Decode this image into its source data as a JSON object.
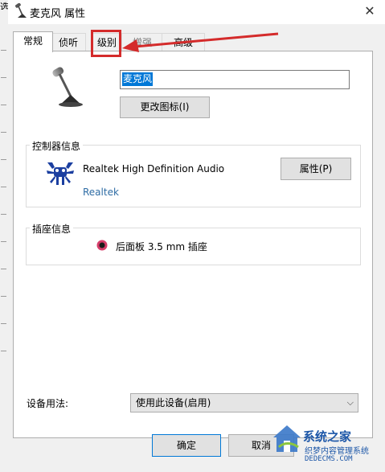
{
  "window": {
    "title": "麦克风 属性",
    "left_fragment": "选",
    "close_glyph": "✕"
  },
  "tabs": [
    {
      "label": "常规",
      "active": true
    },
    {
      "label": "侦听",
      "active": false
    },
    {
      "label": "级别",
      "active": false
    },
    {
      "label": "增强",
      "active": false
    },
    {
      "label": "高级",
      "active": false
    }
  ],
  "device": {
    "name_value": "麦克风",
    "change_icon_button": "更改图标(I)"
  },
  "controller": {
    "group_label": "控制器信息",
    "name": "Realtek High Definition Audio",
    "vendor_link": "Realtek",
    "properties_button": "属性(P)"
  },
  "jack": {
    "group_label": "插座信息",
    "label": "后面板 3.5 mm 插座",
    "color": "#d63d6a"
  },
  "usage": {
    "label": "设备用法:",
    "selected": "使用此设备(启用)"
  },
  "footer": {
    "ok_button": "确定",
    "cancel_button": "取消"
  },
  "annotation": {
    "color": "#d42b2b"
  },
  "watermark": {
    "brand": "系统之家",
    "sub": "织梦内容管理系统",
    "url": "DEDECMS.COM"
  },
  "icons": {
    "title": "microphone-icon",
    "device": "microphone-icon",
    "controller": "realtek-crab-icon",
    "jack": "jack-dot-icon",
    "dropdown": "chevron-down-icon",
    "close": "close-icon"
  }
}
